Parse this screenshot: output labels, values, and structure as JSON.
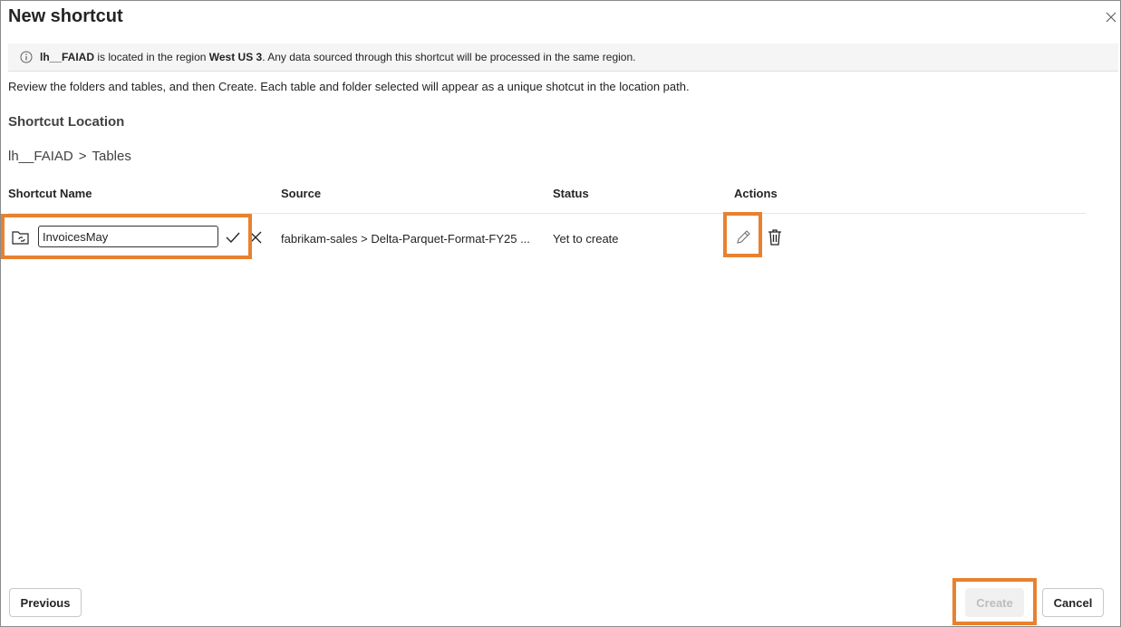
{
  "dialog": {
    "title": "New shortcut",
    "close_icon": "close-icon"
  },
  "info": {
    "lakehouse": "lh__FAIAD",
    "text1": " is located in the region ",
    "region": "West US 3",
    "text2": ". Any data sourced through this shortcut will be processed in the same region."
  },
  "description": "Review the folders and tables, and then Create. Each table and folder selected will appear as a unique shotcut in the location path.",
  "location": {
    "title": "Shortcut Location",
    "path_root": "lh__FAIAD",
    "separator": ">",
    "path_leaf": "Tables"
  },
  "table": {
    "headers": {
      "name": "Shortcut Name",
      "source": "Source",
      "status": "Status",
      "actions": "Actions"
    },
    "rows": [
      {
        "name_value": "InvoicesMay",
        "source": "fabrikam-sales > Delta-Parquet-Format-FY25 ...",
        "status": "Yet to create"
      }
    ]
  },
  "footer": {
    "previous_label": "Previous",
    "create_label": "Create",
    "cancel_label": "Cancel"
  },
  "colors": {
    "highlight": "#e8812f",
    "infobar_bg": "#f5f5f5"
  }
}
